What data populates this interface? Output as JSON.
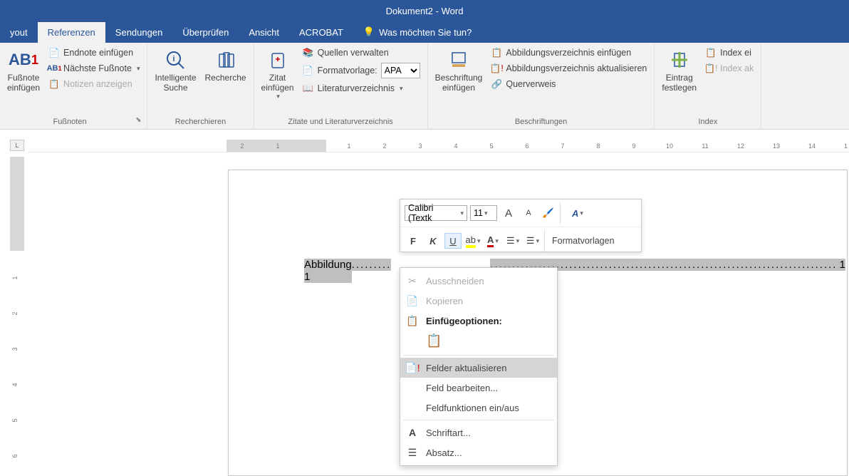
{
  "title": "Dokument2  -  Word",
  "tabs": {
    "layout": "yout",
    "references": "Referenzen",
    "mailings": "Sendungen",
    "review": "Überprüfen",
    "view": "Ansicht",
    "acrobat": "ACROBAT",
    "tellme": "Was möchten Sie tun?"
  },
  "ribbon": {
    "footnotes": {
      "insert_footnote": "Fußnote\neinfügen",
      "insert_endnote": "Endnote einfügen",
      "next_footnote": "Nächste Fußnote",
      "show_notes": "Notizen anzeigen",
      "group": "Fußnoten"
    },
    "research": {
      "smart_lookup": "Intelligente\nSuche",
      "research": "Recherche",
      "group": "Recherchieren"
    },
    "citations": {
      "insert_citation": "Zitat\neinfügen",
      "manage_sources": "Quellen verwalten",
      "style_label": "Formatvorlage:",
      "style_value": "APA",
      "bibliography": "Literaturverzeichnis",
      "group": "Zitate und Literaturverzeichnis"
    },
    "captions": {
      "insert_caption": "Beschriftung\neinfügen",
      "insert_tof": "Abbildungsverzeichnis einfügen",
      "update_tof": "Abbildungsverzeichnis aktualisieren",
      "crossref": "Querverweis",
      "group": "Beschriftungen"
    },
    "index": {
      "mark_entry": "Eintrag\nfestlegen",
      "insert_index": "Index ei",
      "update_index": "Index ak",
      "group": "Index"
    }
  },
  "ruler_corner": "L",
  "toc": {
    "label": "Abbildung 1",
    "page": "1"
  },
  "minitoolbar": {
    "font": "Calibri (Textk",
    "size": "11",
    "grow": "A",
    "shrink": "A",
    "bold": "F",
    "italic": "K",
    "underline": "U",
    "styles": "Formatvorlagen"
  },
  "context": {
    "cut": "Ausschneiden",
    "copy": "Kopieren",
    "paste_options": "Einfügeoptionen:",
    "update_fields": "Felder aktualisieren",
    "edit_field": "Feld bearbeiten...",
    "toggle_codes": "Feldfunktionen ein/aus",
    "font": "Schriftart...",
    "paragraph": "Absatz..."
  }
}
